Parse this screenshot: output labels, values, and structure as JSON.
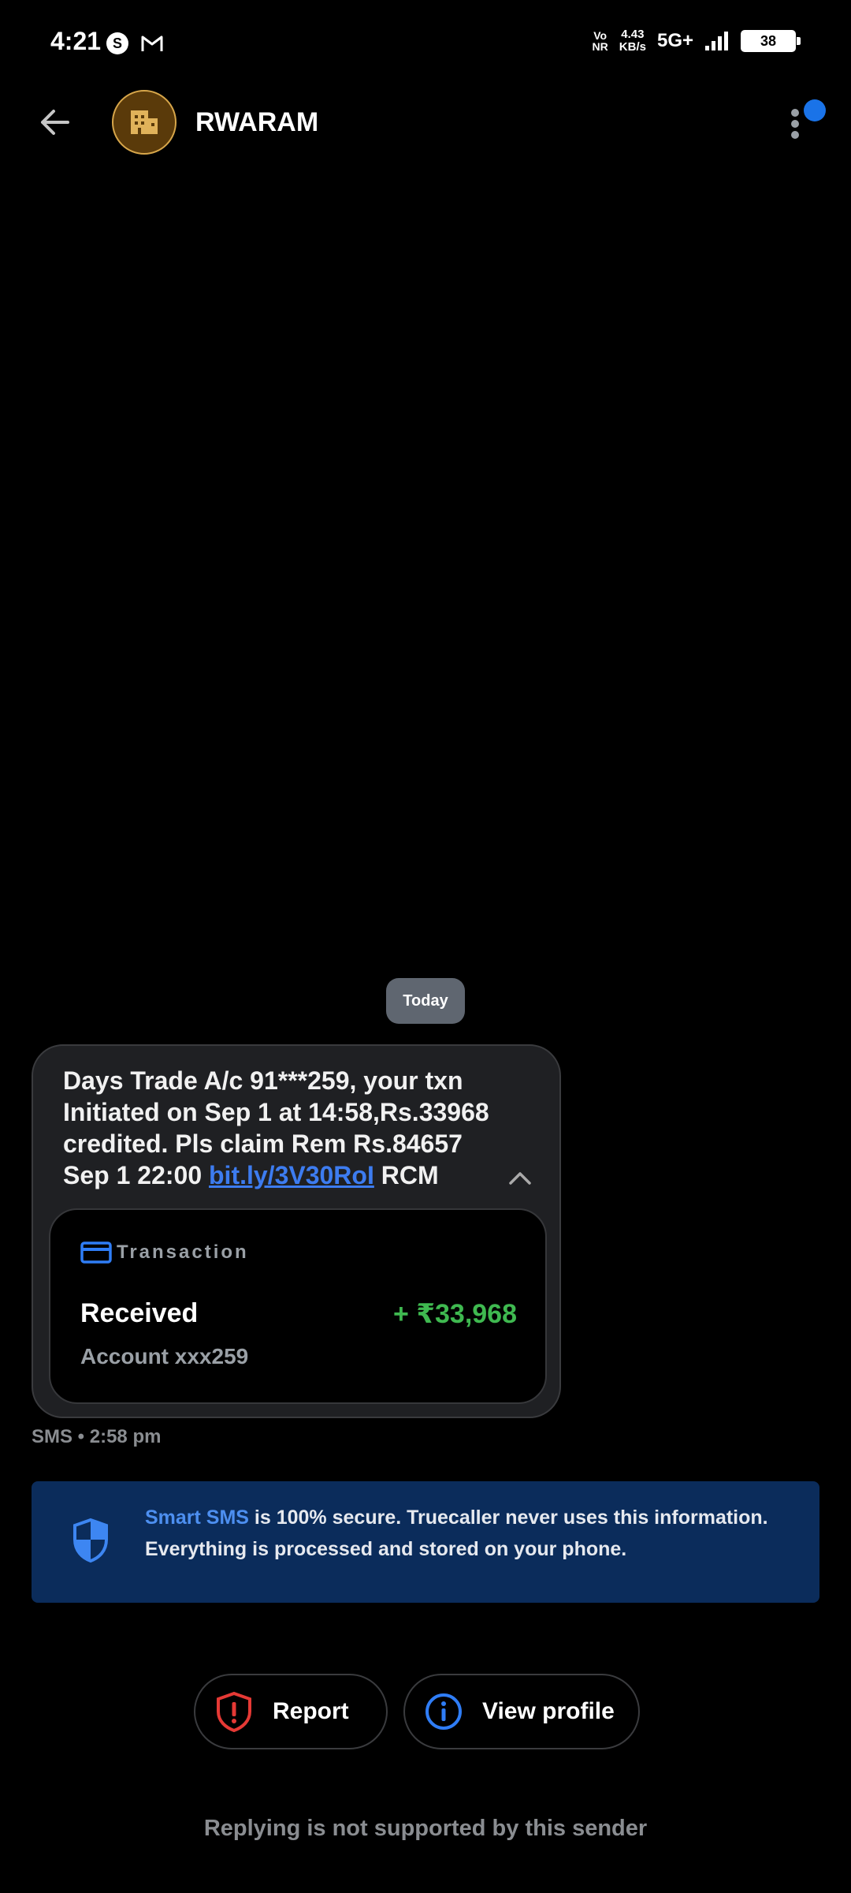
{
  "status_bar": {
    "time": "4:21",
    "volte_top": "Vo",
    "volte_bottom": "NR",
    "speed_value": "4.43",
    "speed_unit": "KB/s",
    "network": "5G+",
    "battery": "38"
  },
  "header": {
    "sender_name": "RWARAM",
    "avatar_icon": "building-icon",
    "back_icon": "arrow-back-icon",
    "more_icon": "more-vertical-icon"
  },
  "conversation": {
    "date_chip": "Today",
    "message": {
      "text_before_link": "Days Trade A/c 91***259, your txn Initiated on Sep 1 at 14:58,Rs.33968 credited. Pls claim Rem Rs.84657 Sep 1 22:00 ",
      "link": "bit.ly/3V30RoI",
      "text_after_link": " RCM",
      "meta": "SMS • 2:58 pm"
    },
    "transaction_card": {
      "title": "Transaction",
      "type_label": "Received",
      "amount": "+ ₹33,968",
      "account": "Account xxx259"
    }
  },
  "smart_sms_banner": {
    "highlight": "Smart SMS",
    "text": " is 100% secure. Truecaller never uses this information. Everything is processed and stored on your phone."
  },
  "actions": {
    "report_label": "Report",
    "view_profile_label": "View profile"
  },
  "footer_note": "Replying is not supported by this sender",
  "colors": {
    "accent_blue": "#1a73e8",
    "amount_green": "#3fb950",
    "report_red": "#e53935",
    "banner_bg": "#0b2c5b"
  }
}
